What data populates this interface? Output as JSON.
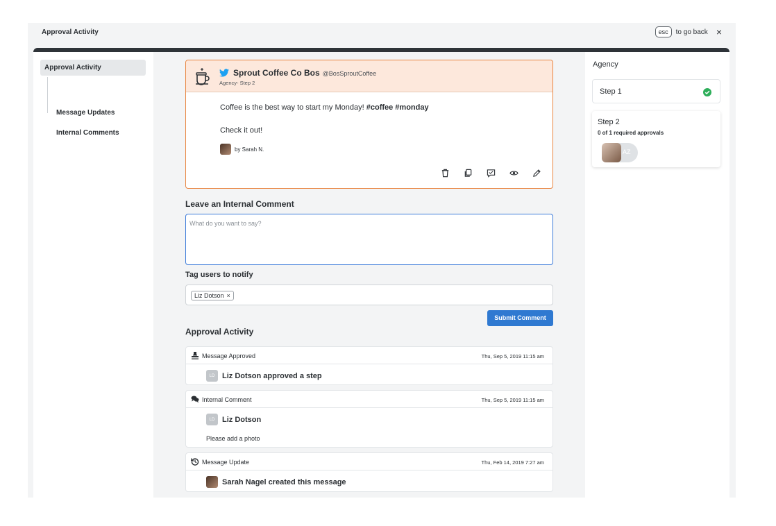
{
  "app": {
    "title": "Approval Activity",
    "esc_key": "esc",
    "esc_label": "to go back",
    "close_glyph": "×"
  },
  "sidebar": {
    "items": [
      {
        "label": "Approval Activity",
        "active": true
      },
      {
        "label": "Message Updates",
        "active": false
      },
      {
        "label": "Internal Comments",
        "active": false
      }
    ]
  },
  "post": {
    "account_name": "Sprout Coffee Co Bos",
    "handle": "@BosSproutCoffee",
    "step": "Agency- Step 2",
    "text_line1": "Coffee is the best way to start my Monday! ",
    "hashtags": "#coffee #monday",
    "text_line2": "Check it out!",
    "author": "by Sarah N.",
    "network_icon": "twitter-icon",
    "actions": [
      "trash-icon",
      "copy-icon",
      "comment-icon",
      "eye-icon",
      "pencil-icon"
    ],
    "accent_color": "#e8843f",
    "header_bg": "#fde8dc"
  },
  "comment_form": {
    "heading": "Leave an Internal Comment",
    "placeholder": "What do you want to say?",
    "tag_heading": "Tag users to notify",
    "tagged_users": [
      {
        "name": "Liz Dotson",
        "remove_glyph": "×"
      }
    ],
    "submit_label": "Submit Comment",
    "submit_color": "#2f79d1"
  },
  "activity": {
    "heading": "Approval Activity",
    "items": [
      {
        "type": "Message Approved",
        "icon": "stamp-icon",
        "date": "Thu, Sep 5, 2019 11:15 am",
        "avatar_initials": "LD",
        "summary": "Liz Dotson approved a step",
        "comment": ""
      },
      {
        "type": "Internal Comment",
        "icon": "comments-icon",
        "date": "Thu, Sep 5, 2019 11:15 am",
        "avatar_initials": "LD",
        "summary": "Liz Dotson",
        "comment": "Please add a photo"
      },
      {
        "type": "Message Update",
        "icon": "history-icon",
        "date": "Thu, Feb 14, 2019 7:27 am",
        "avatar_initials": "",
        "summary": "Sarah Nagel created this message",
        "comment": ""
      }
    ]
  },
  "approvals": {
    "group": "Agency",
    "steps": [
      {
        "label": "Step 1",
        "complete": true,
        "status_text": ""
      },
      {
        "label": "Step 2",
        "complete": false,
        "status_text": "0 of 1 required approvals",
        "approver_initials": "AZ"
      }
    ],
    "check_color": "#2eae5a"
  }
}
